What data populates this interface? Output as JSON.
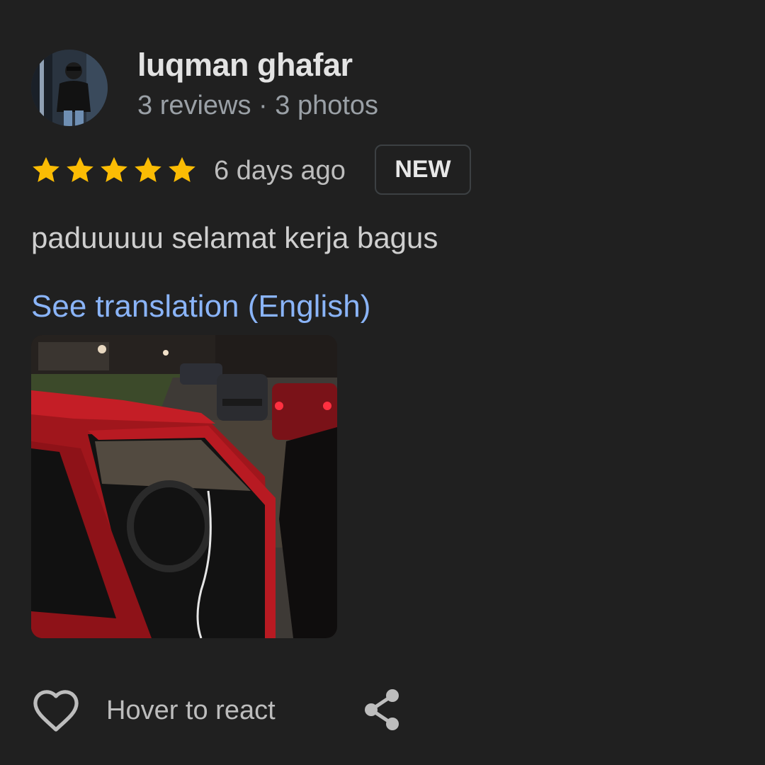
{
  "author": {
    "name": "luqman ghafar",
    "meta": "3 reviews · 3 photos",
    "avatar_icon": "profile-photo"
  },
  "review": {
    "rating": 5,
    "rating_max": 5,
    "star_color": "#fbbc04",
    "time_ago": "6 days ago",
    "badge": "NEW",
    "text": "paduuuuu selamat kerja bagus",
    "translation_link": "See translation (English)",
    "link_color": "#8ab4f8"
  },
  "actions": {
    "react_label": "Hover to react",
    "react_icon": "heart-outline-icon",
    "share_icon": "share-icon"
  }
}
